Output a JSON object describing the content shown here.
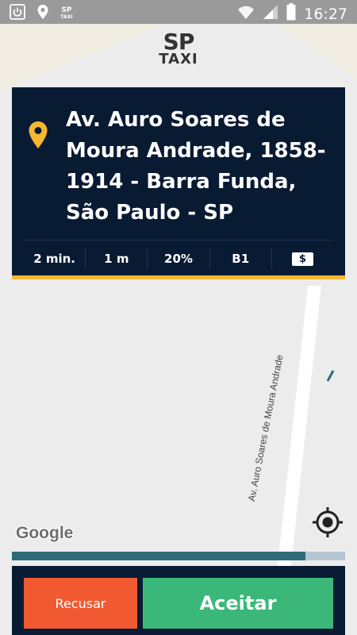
{
  "status_bar": {
    "time": "16:27",
    "left_icons": [
      "power-icon",
      "location-pin-icon",
      "sp-taxi-icon"
    ],
    "right_icons": [
      "wifi-icon",
      "signal-icon",
      "battery-icon"
    ]
  },
  "logo": {
    "line1": "SP",
    "line2": "TAXI"
  },
  "card": {
    "address": "Av. Auro Soares de Moura Andrade, 1858-1914 - Barra Funda, São Paulo - SP",
    "stats": {
      "time": "2 min.",
      "distance": "1 m",
      "percent": "20%",
      "category": "B1",
      "payment_symbol": "$"
    }
  },
  "map": {
    "street_label": "Av. Auro Soares de Moura Andrade",
    "attribution": "Google"
  },
  "progress": {
    "fraction": 0.88
  },
  "actions": {
    "reject_label": "Recusar",
    "accept_label": "Aceitar"
  },
  "colors": {
    "card_bg": "#091a33",
    "accent_yellow": "#f5b731",
    "reject": "#f15a31",
    "accept": "#3bb879",
    "progress_fill": "#2e6b7a"
  }
}
